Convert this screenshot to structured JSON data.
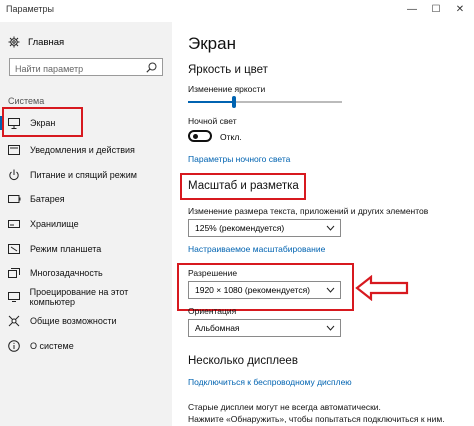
{
  "window": {
    "title": "Параметры",
    "minimize": "—",
    "maximize": "☐",
    "close": "✕"
  },
  "sidebar": {
    "home_label": "Главная",
    "search_placeholder": "Найти параметр",
    "section_label": "Система",
    "items": [
      {
        "label": "Экран",
        "icon": "monitor-icon",
        "active": true
      },
      {
        "label": "Уведомления и действия",
        "icon": "notifications-icon"
      },
      {
        "label": "Питание и спящий режим",
        "icon": "power-icon"
      },
      {
        "label": "Батарея",
        "icon": "battery-icon"
      },
      {
        "label": "Хранилище",
        "icon": "storage-icon"
      },
      {
        "label": "Режим планшета",
        "icon": "tablet-icon"
      },
      {
        "label": "Многозадачность",
        "icon": "multitasking-icon"
      },
      {
        "label": "Проецирование на этот компьютер",
        "icon": "projecting-icon"
      },
      {
        "label": "Общие возможности",
        "icon": "shared-icon"
      },
      {
        "label": "О системе",
        "icon": "info-icon"
      }
    ]
  },
  "main": {
    "title": "Экран",
    "brightness": {
      "heading": "Яркость и цвет",
      "label": "Изменение яркости",
      "level": 0.3
    },
    "night_light": {
      "label": "Ночной свет",
      "state": "Откл.",
      "on": false,
      "settings_link": "Параметры ночного света"
    },
    "scale": {
      "heading": "Масштаб и разметка",
      "label": "Изменение размера текста, приложений и других элементов",
      "value": "125% (рекомендуется)",
      "custom_link": "Настраиваемое масштабирование",
      "resolution_label": "Разрешение",
      "resolution_value": "1920 × 1080 (рекомендуется)",
      "orientation_label": "Ориентация",
      "orientation_value": "Альбомная"
    },
    "multiple_displays": {
      "heading": "Несколько дисплеев",
      "wireless_link": "Подключиться к беспроводному дисплею",
      "description": "Старые дисплеи могут не всегда автоматически.",
      "detect": "Нажмите «Обнаружить», чтобы попытаться подключиться к ним."
    }
  },
  "colors": {
    "accent": "#0063b1",
    "highlight": "#d7191f",
    "sidebar_bg": "#f2f2f2"
  }
}
